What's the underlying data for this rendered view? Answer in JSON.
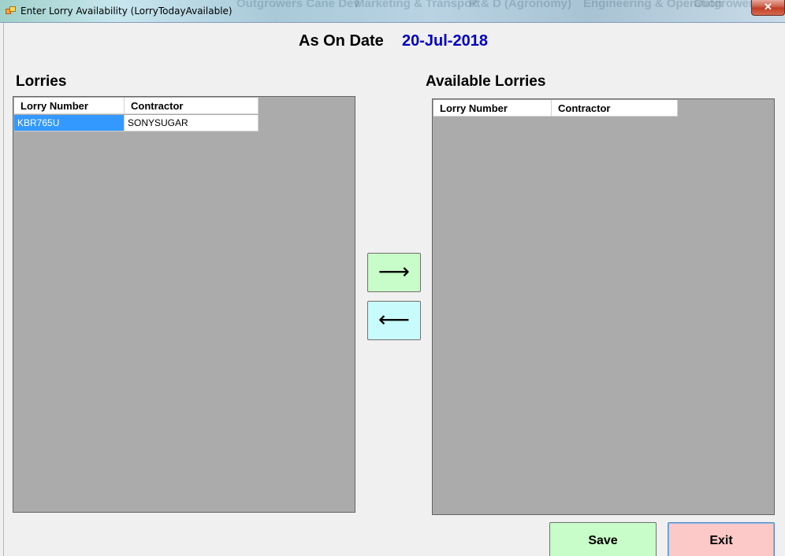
{
  "window": {
    "title": "Enter Lorry Availability (LorryTodayAvailable)",
    "close_glyph": "✕",
    "background_tabs": [
      "Outgrowers Cane Dev",
      "Marketing & Transport",
      "R & D (Agronomy)",
      "Engineering & Operation",
      "Outgrowers Accounts"
    ]
  },
  "header": {
    "as_on_label": "As On Date",
    "as_on_date": "20-Jul-2018"
  },
  "lorries": {
    "title": "Lorries",
    "columns": [
      "Lorry Number",
      "Contractor"
    ],
    "rows": [
      {
        "lorry_number": "KBR765U",
        "contractor": "SONYSUGAR",
        "selected": true
      }
    ]
  },
  "available_lorries": {
    "title": "Available Lorries",
    "columns": [
      "Lorry Number",
      "Contractor"
    ],
    "rows": []
  },
  "transfer": {
    "move_right_icon": "arrow-right",
    "move_right_glyph": "⟶",
    "move_left_icon": "arrow-left",
    "move_left_glyph": "⟵"
  },
  "actions": {
    "save_label": "Save",
    "exit_label": "Exit"
  },
  "colors": {
    "date_color": "#0000c8",
    "selected_cell": "#3399ff",
    "grid_background": "#ababab",
    "save_button": "#c8fcc8",
    "exit_button": "#fcc8c8",
    "move_right_button": "#c8fcc8",
    "move_left_button": "#c8fcfc"
  }
}
